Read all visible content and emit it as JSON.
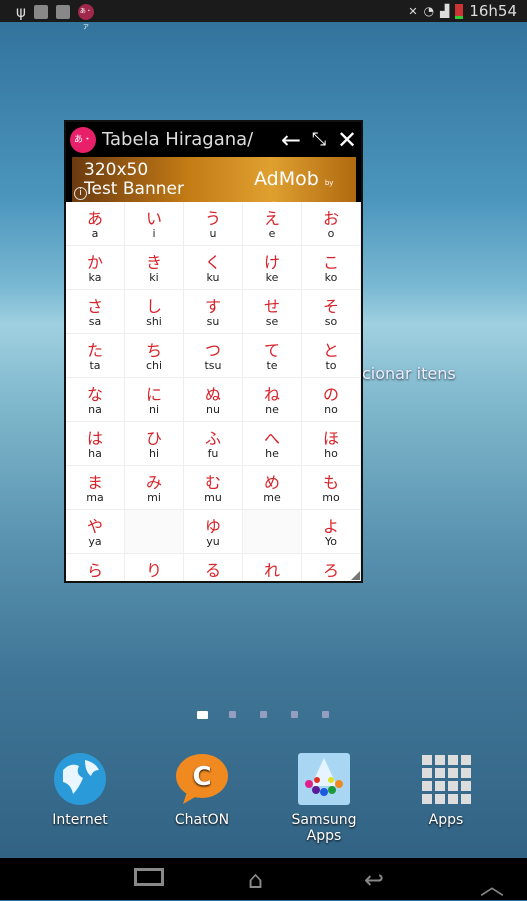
{
  "status": {
    "time": "16h54",
    "left_icons": [
      "usb-icon",
      "sd-card-icon",
      "image-icon",
      "hiragana-app-icon"
    ],
    "right_icons": [
      "mute-icon",
      "wifi-icon",
      "signal-icon",
      "battery-icon"
    ],
    "app_badge": "あ・ア"
  },
  "background_text": "cionar itens",
  "window": {
    "title": "Tabela Hiragana/",
    "logo": "あ・ア",
    "ad": {
      "line1": "320x50",
      "line2": "Test Banner",
      "brand": "AdMob",
      "by": "by Google"
    },
    "grid": [
      [
        [
          "あ",
          "a"
        ],
        [
          "い",
          "i"
        ],
        [
          "う",
          "u"
        ],
        [
          "え",
          "e"
        ],
        [
          "お",
          "o"
        ]
      ],
      [
        [
          "か",
          "ka"
        ],
        [
          "き",
          "ki"
        ],
        [
          "く",
          "ku"
        ],
        [
          "け",
          "ke"
        ],
        [
          "こ",
          "ko"
        ]
      ],
      [
        [
          "さ",
          "sa"
        ],
        [
          "し",
          "shi"
        ],
        [
          "す",
          "su"
        ],
        [
          "せ",
          "se"
        ],
        [
          "そ",
          "so"
        ]
      ],
      [
        [
          "た",
          "ta"
        ],
        [
          "ち",
          "chi"
        ],
        [
          "つ",
          "tsu"
        ],
        [
          "て",
          "te"
        ],
        [
          "と",
          "to"
        ]
      ],
      [
        [
          "な",
          "na"
        ],
        [
          "に",
          "ni"
        ],
        [
          "ぬ",
          "nu"
        ],
        [
          "ね",
          "ne"
        ],
        [
          "の",
          "no"
        ]
      ],
      [
        [
          "は",
          "ha"
        ],
        [
          "ひ",
          "hi"
        ],
        [
          "ふ",
          "fu"
        ],
        [
          "へ",
          "he"
        ],
        [
          "ほ",
          "ho"
        ]
      ],
      [
        [
          "ま",
          "ma"
        ],
        [
          "み",
          "mi"
        ],
        [
          "む",
          "mu"
        ],
        [
          "め",
          "me"
        ],
        [
          "も",
          "mo"
        ]
      ],
      [
        [
          "や",
          "ya"
        ],
        [
          "",
          ""
        ],
        [
          "ゆ",
          "yu"
        ],
        [
          "",
          ""
        ],
        [
          "よ",
          "Yo"
        ]
      ],
      [
        [
          "ら",
          ""
        ],
        [
          "り",
          ""
        ],
        [
          "る",
          ""
        ],
        [
          "れ",
          ""
        ],
        [
          "ろ",
          ""
        ]
      ]
    ]
  },
  "pages": {
    "count": 5,
    "active": 0
  },
  "dock": [
    {
      "label": "Internet",
      "icon": "globe-icon"
    },
    {
      "label": "ChatON",
      "icon": "chaton-icon"
    },
    {
      "label": "Samsung\nApps",
      "icon": "samsung-apps-icon"
    },
    {
      "label": "Apps",
      "icon": "apps-grid-icon"
    }
  ],
  "colors": {
    "kana": "#d8232a",
    "logo": "#e8206a"
  }
}
